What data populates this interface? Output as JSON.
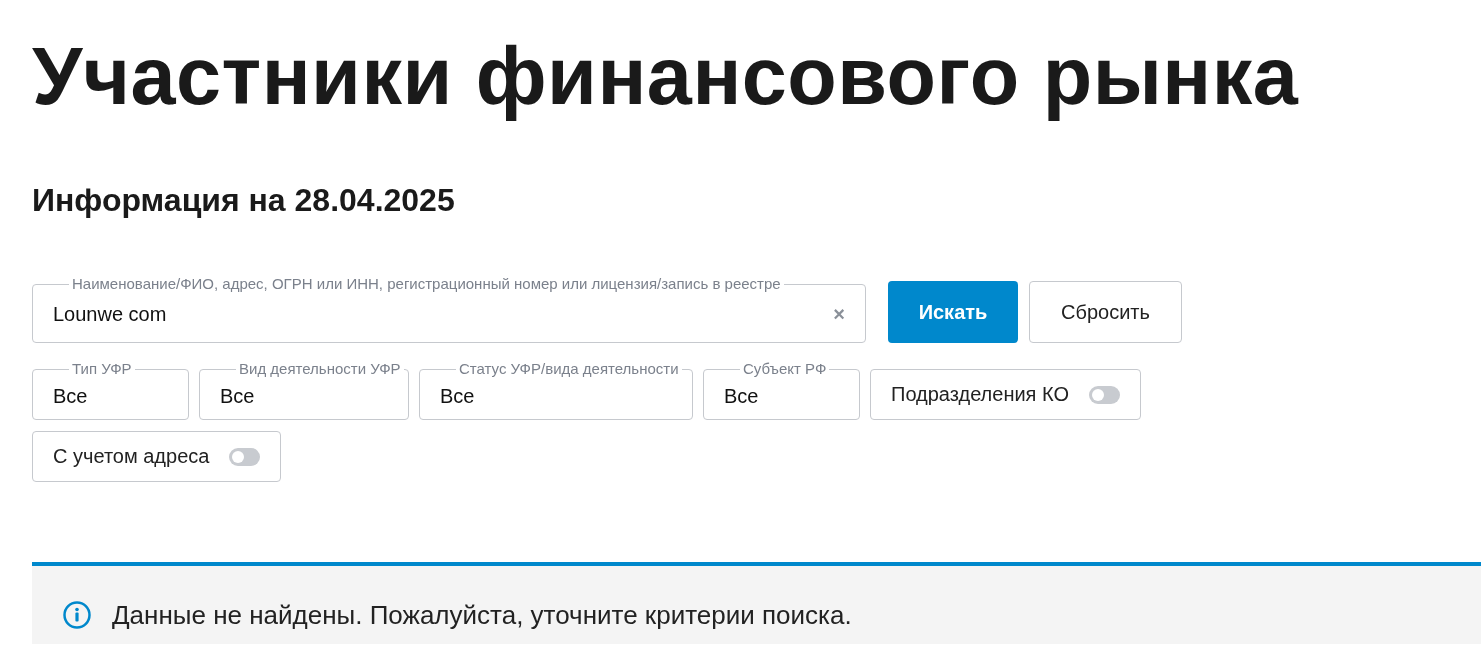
{
  "title": "Участники финансового рынка",
  "subtitle": "Информация на 28.04.2025",
  "search": {
    "label": "Наименование/ФИО, адрес, ОГРН или ИНН, регистрационный номер или лицензия/запись в реестре",
    "value": "Lounwe com",
    "clear": "×"
  },
  "buttons": [
    {
      "label": "Искать",
      "kind": "primary"
    },
    {
      "label": "Сбросить",
      "kind": "secondary"
    }
  ],
  "filters": [
    {
      "kind": "select",
      "label": "Тип УФР",
      "value": "Все"
    },
    {
      "kind": "select",
      "label": "Вид деятельности УФР",
      "value": "Все"
    },
    {
      "kind": "select",
      "label": "Статус УФР/вида деятельности",
      "value": "Все"
    },
    {
      "kind": "select",
      "label": "Субъект РФ",
      "value": "Все"
    },
    {
      "kind": "toggle",
      "label": "Подразделения КО",
      "on": false
    },
    {
      "kind": "toggle",
      "label": "С учетом адреса",
      "on": false
    }
  ],
  "message": {
    "text": "Данные не найдены. Пожалуйста, уточните критерии поиска."
  }
}
